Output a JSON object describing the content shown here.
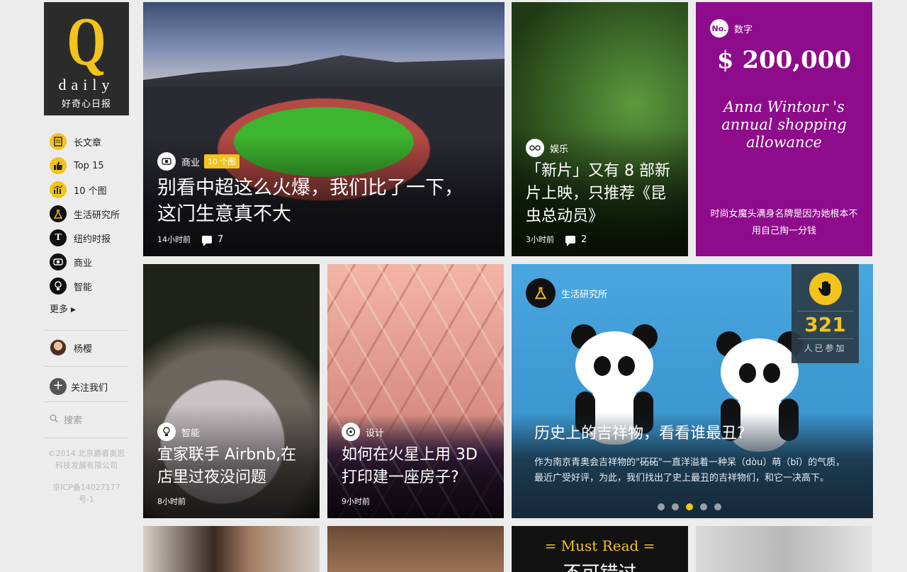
{
  "logo": {
    "letter": "Q",
    "word": "daily",
    "cn": "好奇心日报"
  },
  "nav": [
    {
      "label": "长文章",
      "icon": "document-icon"
    },
    {
      "label": "Top 15",
      "icon": "thumbs-up-icon"
    },
    {
      "label": "10 个图",
      "icon": "chart-icon"
    },
    {
      "label": "生活研究所",
      "icon": "flask-icon"
    },
    {
      "label": "纽约时报",
      "icon": "nyt-icon"
    },
    {
      "label": "商业",
      "icon": "business-icon"
    },
    {
      "label": "智能",
      "icon": "lightbulb-icon"
    }
  ],
  "more_label": "更多",
  "user_name": "杨樱",
  "follow_label": "关注我们",
  "search_label": "搜索",
  "copyright": {
    "line1": "©2014 北京爵睿奥思",
    "line2": "科技发展有限公司",
    "icp1": "京ICP备14027177",
    "icp2": "号-1"
  },
  "cards": {
    "stadium": {
      "tag": "商业",
      "badge": "10 个图",
      "title": "别看中超这么火爆，我们比了一下，这门生意真不大",
      "time": "14小时前",
      "comments": "7"
    },
    "ant": {
      "tag": "娱乐",
      "title": "「新片」又有 8 部新片上映，只推荐《昆虫总动员》",
      "time": "3小时前",
      "comments": "2"
    },
    "number": {
      "tag": "数字",
      "amount": "$ 200,000",
      "headline": "Anna Wintour 's annual shopping allowance",
      "desc": "时尚女魔头满身名牌是因为她根本不用自己掏一分钱"
    },
    "cat": {
      "tag": "智能",
      "title": "宜家联手 Airbnb,在店里过夜没问题",
      "time": "8小时前"
    },
    "print": {
      "tag": "设计",
      "title": "如何在火星上用 3D 打印建一座房子?",
      "time": "9小时前"
    },
    "panda": {
      "tag": "生活研究所",
      "title": "历史上的吉祥物，看看谁最丑?",
      "desc": "作为南京青奥会吉祥物的\"砳砳\"一直洋溢着一种呆（dòu）萌（bī）的气质，最近广受好评，为此，我们找出了史上最丑的吉祥物们，和它一决高下。",
      "votes": "321",
      "vote_label": "人已参加"
    },
    "must": {
      "title": "= Must Read =",
      "sub": "不可错过"
    }
  },
  "accent": "#f2c31b",
  "purple": "#8e0b8b"
}
